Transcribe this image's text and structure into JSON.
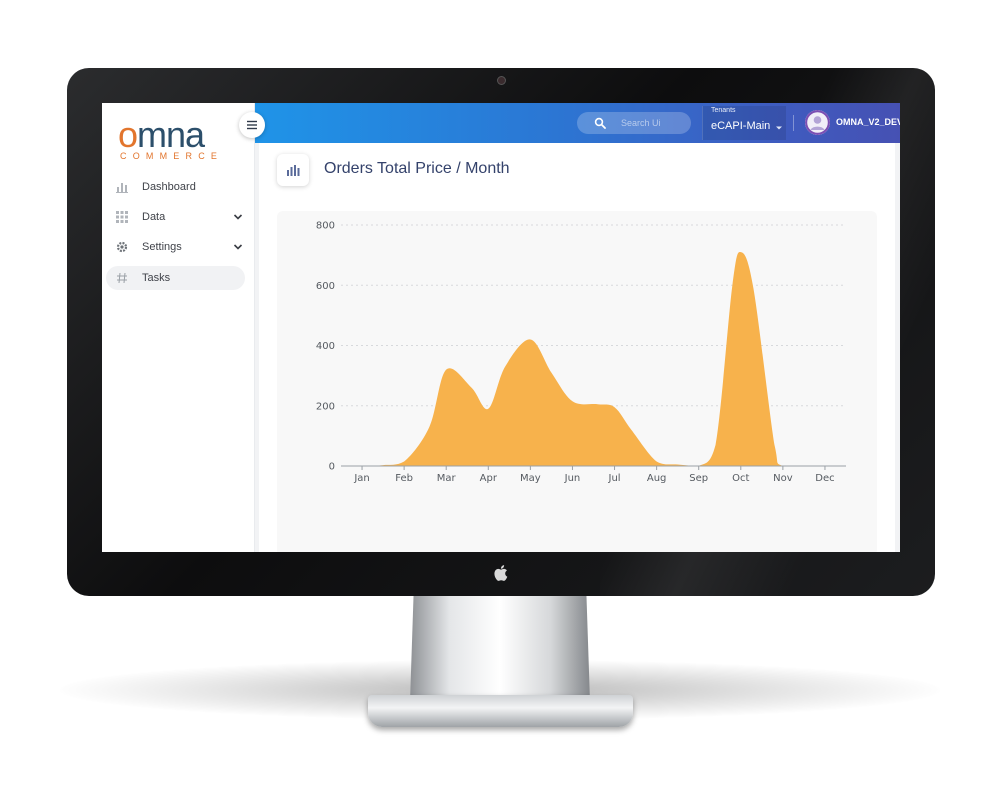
{
  "brand": {
    "name": "omna",
    "tagline": "COMMERCE"
  },
  "sidebar": {
    "items": [
      {
        "label": "Dashboard",
        "icon": "bar-chart-icon",
        "expandable": false
      },
      {
        "label": "Data",
        "icon": "grid-icon",
        "expandable": true
      },
      {
        "label": "Settings",
        "icon": "gear-icon",
        "expandable": true
      },
      {
        "label": "Tasks",
        "icon": "hash-icon",
        "expandable": false,
        "active": true
      }
    ]
  },
  "topbar": {
    "search_placeholder": "Search Ui",
    "tenant_caption": "Tenants",
    "tenant_value": "eCAPI-Main",
    "user_name": "OMNA_V2_DEV"
  },
  "page": {
    "title": "Orders Total Price / Month"
  },
  "colors": {
    "accent_orange": "#e2752d",
    "brand_navy": "#2c4f6b",
    "chart_fill": "#f7b24c",
    "topbar_start": "#1f94e8",
    "topbar_end": "#4651b3"
  },
  "chart_data": {
    "type": "area",
    "categories": [
      "Jan",
      "Feb",
      "Mar",
      "Apr",
      "May",
      "Jun",
      "Jul",
      "Aug",
      "Sep",
      "Oct",
      "Nov",
      "Dec"
    ],
    "x": [
      0,
      0.5,
      1,
      1.6,
      2,
      2.6,
      3,
      3.4,
      4,
      4.5,
      5,
      5.6,
      6,
      6.4,
      7,
      7.5,
      8,
      8.4,
      8.8,
      9,
      9.3,
      9.8,
      10,
      11
    ],
    "values": [
      0,
      3,
      15,
      130,
      320,
      260,
      190,
      330,
      420,
      310,
      215,
      205,
      195,
      120,
      15,
      5,
      0,
      70,
      600,
      710,
      590,
      70,
      0,
      0
    ],
    "title": "Orders Total Price / Month",
    "xlabel": "",
    "ylabel": "",
    "ylim": [
      0,
      800
    ],
    "yticks": [
      0,
      200,
      400,
      600,
      800
    ],
    "grid": true,
    "legend": "none"
  }
}
